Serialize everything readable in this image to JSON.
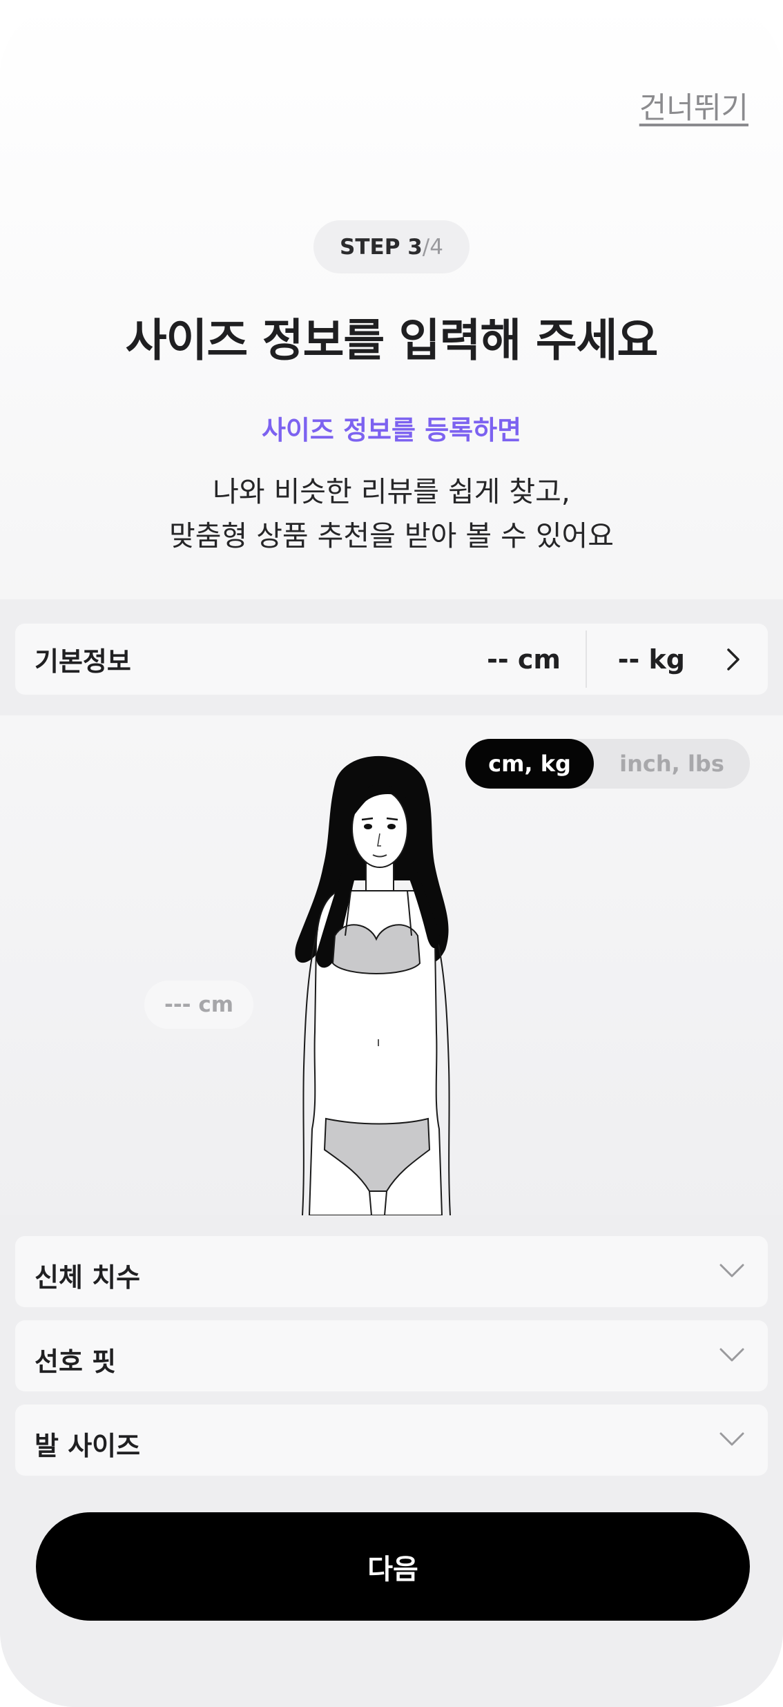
{
  "header": {
    "skip_label": "건너뛰기"
  },
  "step": {
    "current": "STEP 3",
    "total": "/4"
  },
  "title": "사이즈 정보를 입력해 주세요",
  "accent_text": "사이즈 정보를 등록하면",
  "description": {
    "line1": "나와 비슷한 리뷰를 쉽게 찾고,",
    "line2": "맞춤형 상품 추천을 받아 볼 수 있어요"
  },
  "basic_info": {
    "label": "기본정보",
    "height": "-- cm",
    "weight": "-- kg"
  },
  "unit_toggle": {
    "selected": "cm, kg",
    "other": "inch, lbs"
  },
  "measurement_bubble": "--- cm",
  "accordions": {
    "body": "신체 치수",
    "fit": "선호 핏",
    "foot": "발 사이즈"
  },
  "next_button": "다음",
  "colors": {
    "accent": "#7c62f0",
    "button": "#000000"
  }
}
